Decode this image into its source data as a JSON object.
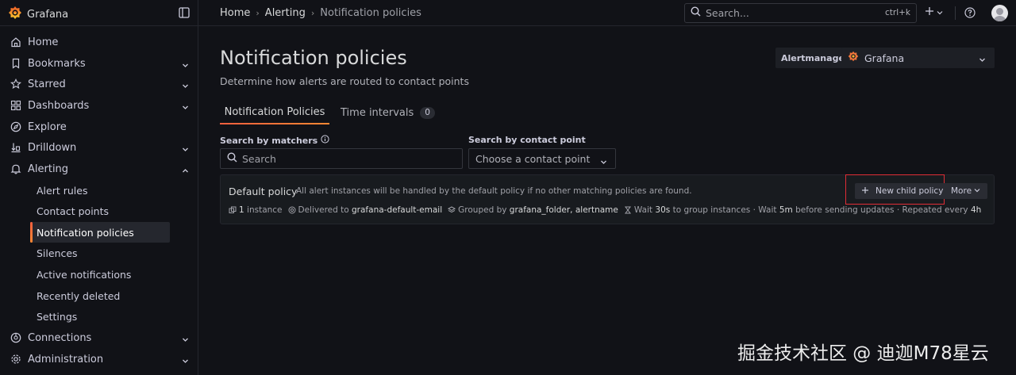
{
  "app": {
    "brand_name": "Grafana"
  },
  "breadcrumb": [
    {
      "label": "Home"
    },
    {
      "label": "Alerting"
    },
    {
      "label": "Notification policies"
    }
  ],
  "search": {
    "placeholder": "Search...",
    "shortcut": "ctrl+k"
  },
  "sidebar": {
    "items": [
      {
        "label": "Home"
      },
      {
        "label": "Bookmarks"
      },
      {
        "label": "Starred"
      },
      {
        "label": "Dashboards"
      },
      {
        "label": "Explore"
      },
      {
        "label": "Drilldown"
      },
      {
        "label": "Alerting"
      },
      {
        "label": "Connections"
      },
      {
        "label": "Administration"
      }
    ],
    "alerting_children": [
      {
        "label": "Alert rules"
      },
      {
        "label": "Contact points"
      },
      {
        "label": "Notification policies"
      },
      {
        "label": "Silences"
      },
      {
        "label": "Active notifications"
      },
      {
        "label": "Recently deleted"
      },
      {
        "label": "Settings"
      }
    ]
  },
  "page": {
    "title": "Notification policies",
    "subtitle": "Determine how alerts are routed to contact points"
  },
  "alertmanager": {
    "label": "Alertmanager",
    "selected": "Grafana"
  },
  "tabs": [
    {
      "label": "Notification Policies"
    },
    {
      "label": "Time intervals",
      "count": "0"
    }
  ],
  "filters": {
    "matchers_label": "Search by matchers",
    "matchers_placeholder": "Search",
    "contact_point_label": "Search by contact point",
    "contact_point_placeholder": "Choose a contact point"
  },
  "policy": {
    "title": "Default policy",
    "description": "All alert instances will be handled by the default policy if no other matching policies are found.",
    "new_child_label": "New child policy",
    "more_label": "More",
    "meta": {
      "instances_value": "1",
      "instances_label": "instance",
      "delivered_prefix": "Delivered to",
      "delivered_value": "grafana-default-email",
      "grouped_prefix": "Grouped by",
      "grouped_value": "grafana_folder, alertname",
      "wait_prefix": "Wait",
      "group_wait": "30s",
      "group_wait_suffix": "to group instances",
      "dot": "·",
      "wait2_prefix": "Wait",
      "group_interval": "5m",
      "group_interval_suffix": "before sending updates",
      "repeat_prefix": "Repeated every",
      "repeat_interval": "4h"
    }
  },
  "watermark": "掘金技术社区 @ 迪迦M78星云",
  "colors": {
    "accent": "#f55f3e",
    "highlight_box": "#e02d36",
    "background": "#111217"
  }
}
